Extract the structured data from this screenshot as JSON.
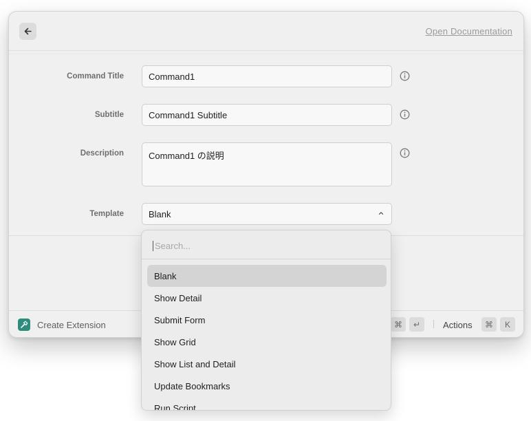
{
  "header": {
    "doc_link": "Open Documentation"
  },
  "form": {
    "command_title": {
      "label": "Command Title",
      "value": "Command1"
    },
    "subtitle": {
      "label": "Subtitle",
      "value": "Command1  Subtitle"
    },
    "description": {
      "label": "Description",
      "value": "Command1 の説明"
    },
    "template": {
      "label": "Template",
      "value": "Blank"
    }
  },
  "dropdown": {
    "search_placeholder": "Search...",
    "items": [
      {
        "label": "Blank",
        "selected": true
      },
      {
        "label": "Show Detail"
      },
      {
        "label": "Submit Form"
      },
      {
        "label": "Show Grid"
      },
      {
        "label": "Show List and Detail"
      },
      {
        "label": "Update Bookmarks"
      },
      {
        "label": "Run Script"
      }
    ]
  },
  "footer": {
    "extension_label": "Create Extension",
    "submit_keys": [
      "⌘",
      "↵"
    ],
    "actions_label": "Actions",
    "actions_keys": [
      "⌘",
      "K"
    ]
  },
  "colors": {
    "accent_icon": "#2e8c7c",
    "window_bg": "#f0f0f0",
    "selected_bg": "#d4d4d4"
  }
}
